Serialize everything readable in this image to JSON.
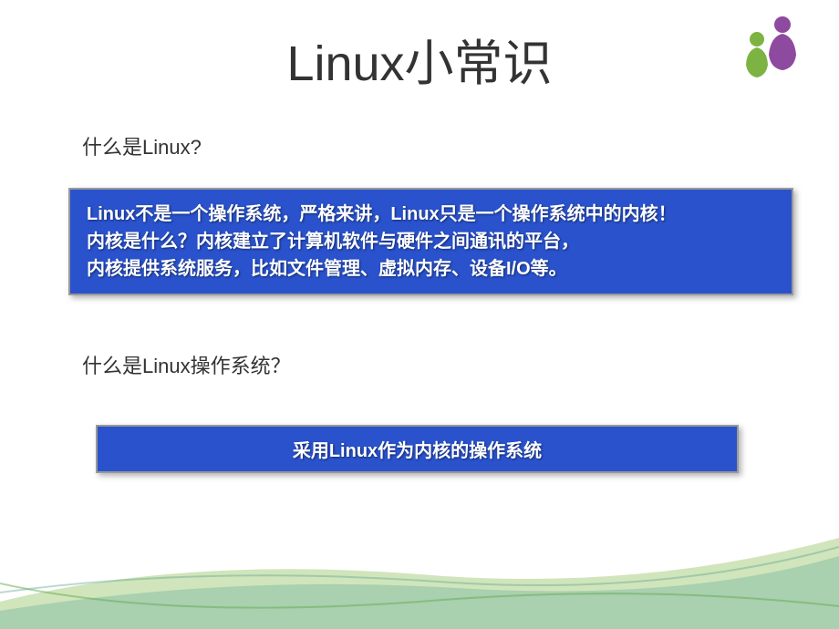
{
  "title": "Linux小常识",
  "question1": "什么是Linux?",
  "answer1_line1": "Linux不是一个操作系统，严格来讲，Linux只是一个操作系统中的内核！",
  "answer1_line2": "内核是什么？内核建立了计算机软件与硬件之间通讯的平台，",
  "answer1_line3": "内核提供系统服务，比如文件管理、虚拟内存、设备I/O等。",
  "question2": "什么是Linux操作系统？",
  "answer2": "采用Linux作为内核的操作系统",
  "logo": {
    "purple_color": "#8e4a9e",
    "green_color": "#7cb342"
  },
  "swoosh": {
    "green": "rgba(120, 180, 60, 0.4)",
    "teal": "rgba(80, 160, 150, 0.3)"
  }
}
